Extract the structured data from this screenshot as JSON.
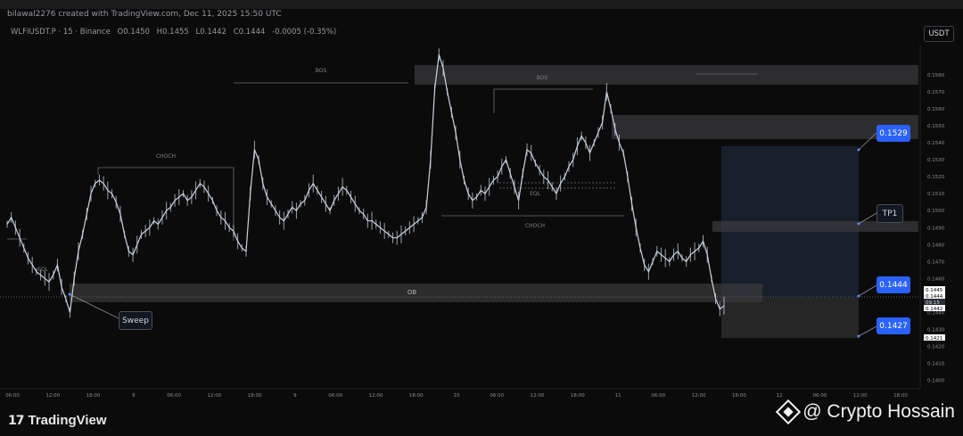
{
  "header": {
    "attribution": "bilawal2276 created with TradingView.com, Dec 11, 2025 15:50 UTC",
    "symbol": "WLFIUSDT.P · 15 · Binance",
    "open": "O0.1450",
    "high": "H0.1455",
    "low": "L0.1442",
    "close": "C0.1444",
    "change": "-0.0005 (-0.35%)",
    "currency": "USDT"
  },
  "callouts": {
    "tp2": "0.1529",
    "tp1": "TP1",
    "entry": "0.1444",
    "stop": "0.1427",
    "sweep": "Sweep"
  },
  "chart_data": {
    "type": "line",
    "title": "",
    "xlabel": "",
    "ylabel": "",
    "ylim": [
      0.1395,
      0.16
    ],
    "grid": false,
    "colors": {
      "price": "#c9d4e4",
      "background": "#0b0b0b",
      "long_zone": "#1a2530",
      "stop_zone": "#2c2c2c",
      "callout": "#2962ff"
    },
    "x_ticks": [
      "06:00",
      "12:00",
      "18:00",
      "8",
      "06:00",
      "12:00",
      "18:00",
      "9",
      "06:00",
      "12:00",
      "18:00",
      "10",
      "06:00",
      "12:00",
      "18:00",
      "11",
      "06:00",
      "12:00",
      "18:00",
      "12",
      "06:00",
      "12:00",
      "18:00"
    ],
    "y_ticks": [
      "0.1580",
      "0.1570",
      "0.1560",
      "0.1550",
      "0.1540",
      "0.1530",
      "0.1520",
      "0.1510",
      "0.1500",
      "0.1490",
      "0.1480",
      "0.1470",
      "0.1460",
      "0.1450",
      "0.1440",
      "0.1430",
      "0.1420",
      "0.1410",
      "0.1400"
    ],
    "price_labels": [
      "0.1445",
      "0.1444",
      "09:15",
      "0.1442",
      "0.1421"
    ],
    "series": [
      {
        "values": [
          0.1492,
          0.1496,
          0.149,
          0.1484,
          0.1478,
          0.1472,
          0.1468,
          0.1464,
          0.1462,
          0.146,
          0.1458,
          0.1462,
          0.1468,
          0.1455,
          0.1448,
          0.144,
          0.146,
          0.1476,
          0.1486,
          0.1498,
          0.151,
          0.1516,
          0.1518,
          0.1516,
          0.1512,
          0.151,
          0.1505,
          0.1498,
          0.1486,
          0.1476,
          0.1474,
          0.148,
          0.1486,
          0.1488,
          0.149,
          0.1494,
          0.1492,
          0.1496,
          0.15,
          0.1502,
          0.1506,
          0.1508,
          0.151,
          0.1506,
          0.1508,
          0.1512,
          0.1516,
          0.1514,
          0.151,
          0.1506,
          0.15,
          0.1496,
          0.1494,
          0.149,
          0.1488,
          0.1482,
          0.1478,
          0.1476,
          0.151,
          0.1536,
          0.153,
          0.1516,
          0.1508,
          0.1504,
          0.15,
          0.1496,
          0.1494,
          0.1498,
          0.1502,
          0.15,
          0.1504,
          0.1506,
          0.1512,
          0.1516,
          0.1512,
          0.1508,
          0.1504,
          0.15,
          0.1506,
          0.151,
          0.1514,
          0.1512,
          0.1508,
          0.1504,
          0.15,
          0.1498,
          0.1494,
          0.1494,
          0.1492,
          0.149,
          0.1488,
          0.1486,
          0.1484,
          0.1484,
          0.1486,
          0.1488,
          0.149,
          0.1492,
          0.1494,
          0.1496,
          0.1502,
          0.153,
          0.1572,
          0.1592,
          0.1584,
          0.157,
          0.1558,
          0.1546,
          0.153,
          0.1518,
          0.151,
          0.1506,
          0.1508,
          0.1512,
          0.151,
          0.1514,
          0.1518,
          0.152,
          0.1526,
          0.153,
          0.1522,
          0.1514,
          0.1506,
          0.1522,
          0.1536,
          0.1534,
          0.1528,
          0.1524,
          0.152,
          0.1518,
          0.1514,
          0.151,
          0.1516,
          0.152,
          0.1526,
          0.153,
          0.1538,
          0.1544,
          0.154,
          0.1534,
          0.154,
          0.1546,
          0.1552,
          0.157,
          0.156,
          0.1548,
          0.154,
          0.1534,
          0.152,
          0.1504,
          0.149,
          0.1478,
          0.1468,
          0.1464,
          0.147,
          0.1476,
          0.1474,
          0.1472,
          0.147,
          0.1474,
          0.1476,
          0.1472,
          0.147,
          0.1474,
          0.1476,
          0.1478,
          0.1482,
          0.1474,
          0.146,
          0.1448,
          0.1442,
          0.1444
        ]
      }
    ],
    "annotations": {
      "zone_labels": [
        "BOS",
        "BOS",
        "CHOCH",
        "CHOCH",
        "OB",
        "EQL",
        "EQL"
      ],
      "levels": [
        0.1529,
        0.1485,
        0.1444,
        0.1427
      ]
    }
  }
}
